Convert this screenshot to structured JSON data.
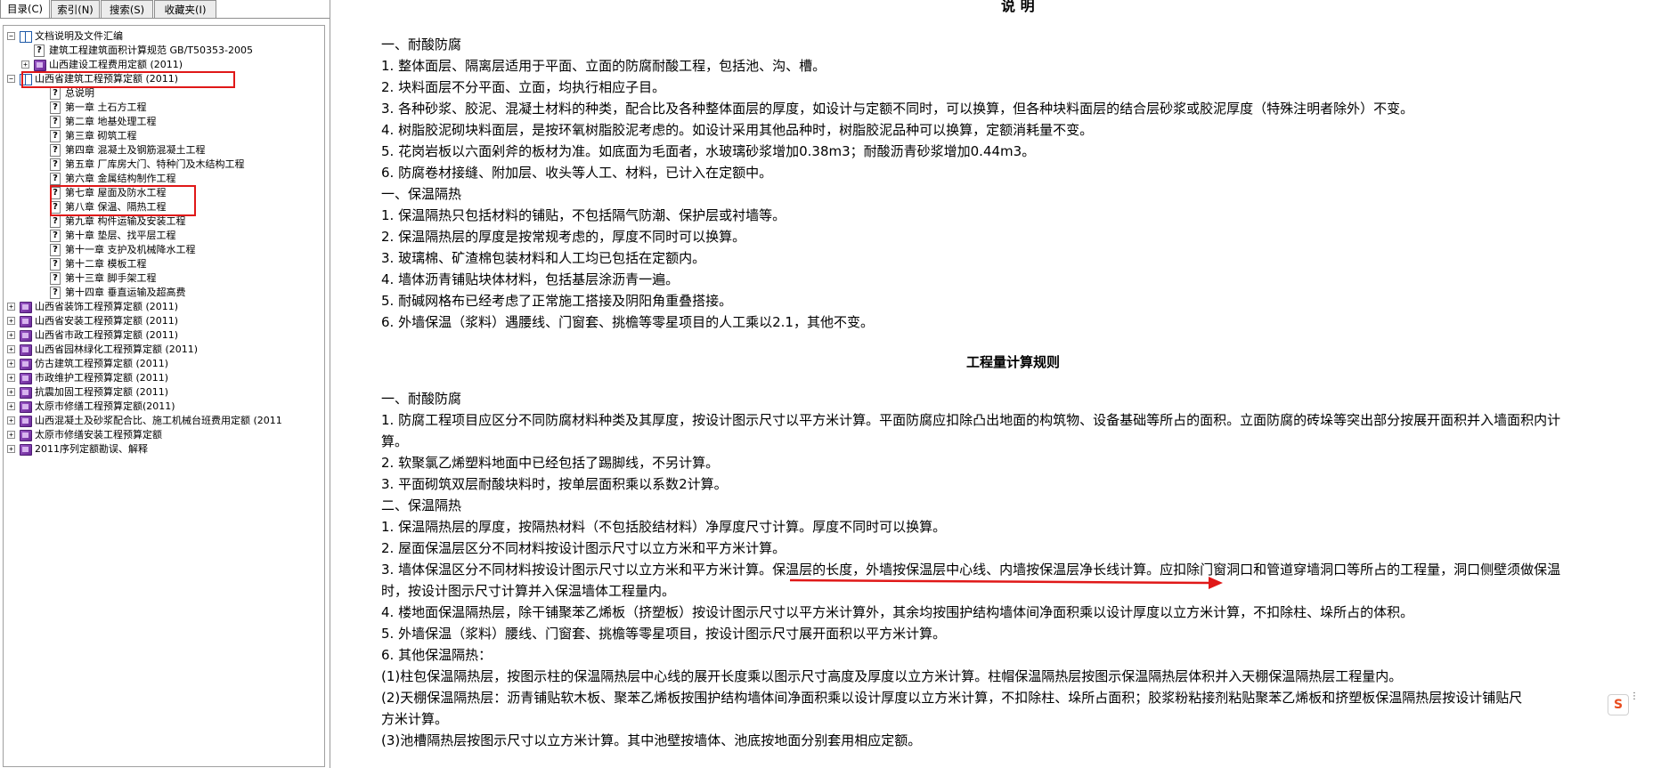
{
  "tabs": [
    "目录(C)",
    "索引(N)",
    "搜索(S)",
    "收藏夹(I)"
  ],
  "tree": [
    {
      "label": "文档说明及文件汇编",
      "exp": "−",
      "icon": "openbook",
      "level": 0
    },
    {
      "label": "建筑工程建筑面积计算规范 GB/T50353-2005",
      "exp": "",
      "icon": "help",
      "level": 1
    },
    {
      "label": "山西建设工程费用定额 (2011)",
      "exp": "+",
      "icon": "book",
      "level": 1
    },
    {
      "label": "山西省建筑工程预算定额 (2011)",
      "exp": "−",
      "icon": "openbook",
      "level": 0
    },
    {
      "label": "总说明",
      "exp": "",
      "icon": "help",
      "level": 2
    },
    {
      "label": "第一章 土石方工程",
      "exp": "",
      "icon": "help",
      "level": 2
    },
    {
      "label": "第二章 地基处理工程",
      "exp": "",
      "icon": "help",
      "level": 2
    },
    {
      "label": "第三章 砌筑工程",
      "exp": "",
      "icon": "help",
      "level": 2
    },
    {
      "label": "第四章 混凝土及钢筋混凝土工程",
      "exp": "",
      "icon": "help",
      "level": 2
    },
    {
      "label": "第五章 厂库房大门、特种门及木结构工程",
      "exp": "",
      "icon": "help",
      "level": 2
    },
    {
      "label": "第六章 金属结构制作工程",
      "exp": "",
      "icon": "help",
      "level": 2
    },
    {
      "label": "第七章 屋面及防水工程",
      "exp": "",
      "icon": "help",
      "level": 2
    },
    {
      "label": "第八章 保温、隔热工程",
      "exp": "",
      "icon": "help",
      "level": 2
    },
    {
      "label": "第九章 构件运输及安装工程",
      "exp": "",
      "icon": "help",
      "level": 2
    },
    {
      "label": "第十章 垫层、找平层工程",
      "exp": "",
      "icon": "help",
      "level": 2
    },
    {
      "label": "第十一章 支护及机械降水工程",
      "exp": "",
      "icon": "help",
      "level": 2
    },
    {
      "label": "第十二章 模板工程",
      "exp": "",
      "icon": "help",
      "level": 2
    },
    {
      "label": "第十三章 脚手架工程",
      "exp": "",
      "icon": "help",
      "level": 2
    },
    {
      "label": "第十四章 垂直运输及超高费",
      "exp": "",
      "icon": "help",
      "level": 2
    },
    {
      "label": "山西省装饰工程预算定额 (2011)",
      "exp": "+",
      "icon": "book",
      "level": 0
    },
    {
      "label": "山西省安装工程预算定额 (2011)",
      "exp": "+",
      "icon": "book",
      "level": 0
    },
    {
      "label": "山西省市政工程预算定额 (2011)",
      "exp": "+",
      "icon": "book",
      "level": 0
    },
    {
      "label": "山西省园林绿化工程预算定额 (2011)",
      "exp": "+",
      "icon": "book",
      "level": 0
    },
    {
      "label": "仿古建筑工程预算定额 (2011)",
      "exp": "+",
      "icon": "book",
      "level": 0
    },
    {
      "label": "市政维护工程预算定额 (2011)",
      "exp": "+",
      "icon": "book",
      "level": 0
    },
    {
      "label": "抗震加固工程预算定额 (2011)",
      "exp": "+",
      "icon": "book",
      "level": 0
    },
    {
      "label": "太原市修缮工程预算定额(2011)",
      "exp": "+",
      "icon": "book",
      "level": 0
    },
    {
      "label": "山西混凝土及砂浆配合比、施工机械台班费用定额 (2011",
      "exp": "+",
      "icon": "book",
      "level": 0
    },
    {
      "label": "太原市修缮安装工程预算定额",
      "exp": "+",
      "icon": "book",
      "level": 0
    },
    {
      "label": "2011序列定额勘误、解释",
      "exp": "+",
      "icon": "book",
      "level": 0
    }
  ],
  "doc": {
    "title1": "说  明",
    "title2": "工程量计算规则",
    "lines1": [
      "一、耐酸防腐",
      "1. 整体面层、隔离层适用于平面、立面的防腐耐酸工程，包括池、沟、槽。",
      "2. 块料面层不分平面、立面，均执行相应子目。",
      "3. 各种砂浆、胶泥、混凝土材料的种类，配合比及各种整体面层的厚度，如设计与定额不同时，可以换算，但各种块料面层的结合层砂浆或胶泥厚度（特殊注明者除外）不变。",
      "4. 树脂胶泥砌块料面层，是按环氧树脂胶泥考虑的。如设计采用其他品种时，树脂胶泥品种可以换算，定额消耗量不变。",
      "5. 花岗岩板以六面剁斧的板材为准。如底面为毛面者，水玻璃砂浆增加0.38m3；耐酸沥青砂浆增加0.44m3。",
      "6. 防腐卷材接缝、附加层、收头等人工、材料，已计入在定额中。",
      "一、保温隔热",
      "1. 保温隔热只包括材料的铺贴，不包括隔气防潮、保护层或衬墙等。",
      "2. 保温隔热层的厚度是按常规考虑的，厚度不同时可以换算。",
      "3. 玻璃棉、矿渣棉包装材料和人工均已包括在定额内。",
      "4. 墙体沥青铺贴块体材料，包括基层涂沥青一遍。",
      "5. 耐碱网格布已经考虑了正常施工搭接及阴阳角重叠搭接。",
      "6. 外墙保温（浆料）遇腰线、门窗套、挑檐等零星项目的人工乘以2.1，其他不变。"
    ],
    "lines2": [
      "一、耐酸防腐",
      "1. 防腐工程项目应区分不同防腐材料种类及其厚度，按设计图示尺寸以平方米计算。平面防腐应扣除凸出地面的构筑物、设备基础等所占的面积。立面防腐的砖垛等突出部分按展开面积并入墙面积内计",
      "算。",
      "2. 软聚氯乙烯塑料地面中已经包括了踢脚线，不另计算。",
      "3. 平面砌筑双层耐酸块料时，按单层面积乘以系数2计算。",
      "二、保温隔热",
      "1. 保温隔热层的厚度，按隔热材料（不包括胶结材料）净厚度尺寸计算。厚度不同时可以换算。",
      "2. 屋面保温层区分不同材料按设计图示尺寸以立方米和平方米计算。",
      "3. 墙体保温区分不同材料按设计图示尺寸以立方米和平方米计算。保温层的长度，外墙按保温层中心线、内墙按保温层净长线计算。应扣除门窗洞口和管道穿墙洞口等所占的工程量，洞口侧壁须做保温",
      "时，按设计图示尺寸计算并入保温墙体工程量内。",
      "4. 楼地面保温隔热层，除干铺聚苯乙烯板（挤塑板）按设计图示尺寸以平方米计算外，其余均按围护结构墙体间净面积乘以设计厚度以立方米计算，不扣除柱、垛所占的体积。",
      "5. 外墙保温（浆料）腰线、门窗套、挑檐等零星项目，按设计图示尺寸展开面积以平方米计算。",
      "6. 其他保温隔热：",
      "(1)柱包保温隔热层，按图示柱的保温隔热层中心线的展开长度乘以图示尺寸高度及厚度以立方米计算。柱帽保温隔热层按图示保温隔热层体积并入天棚保温隔热层工程量内。",
      "(2)天棚保温隔热层：沥青铺贴软木板、聚苯乙烯板按围护结构墙体间净面积乘以设计厚度以立方米计算，不扣除柱、垛所占面积；胶浆粉粘接剂粘贴聚苯乙烯板和挤塑板保温隔热层按设计铺贴尺",
      "方米计算。",
      "(3)池槽隔热层按图示尺寸以立方米计算。其中池壁按墙体、池底按地面分别套用相应定额。"
    ]
  },
  "ime_badge": "S",
  "colors": {
    "highlight": "#e01818",
    "arrow": "#e01818",
    "book": "#7b3aa8",
    "tree_line": "#a0a0a0"
  }
}
